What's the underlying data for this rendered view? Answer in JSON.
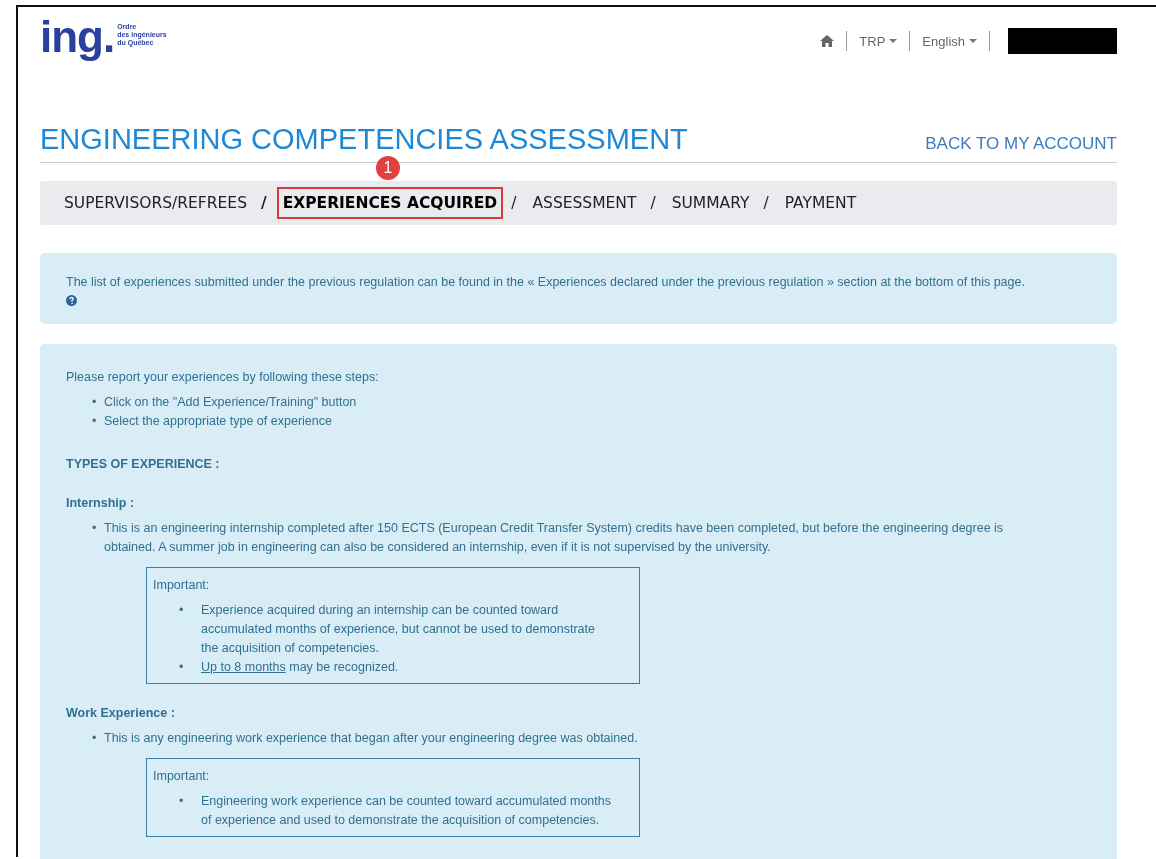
{
  "logo": {
    "wordmark": "ing.",
    "org_lines": [
      "Ordre",
      "des ingénieurs",
      "du Québec"
    ]
  },
  "top_nav": [
    {
      "kind": "home"
    },
    {
      "kind": "dropdown",
      "label": "TRP"
    },
    {
      "kind": "dropdown",
      "label": "English"
    },
    {
      "kind": "redacted"
    }
  ],
  "page_title": "ENGINEERING COMPETENCIES ASSESSMENT",
  "back_link": "BACK TO MY ACCOUNT",
  "steps": [
    {
      "label": "SUPERVISORS/REFREES",
      "selected": false,
      "separator": "/",
      "separator_bold": true
    },
    {
      "label": "EXPERIENCES ACQUIRED",
      "selected": true,
      "separator": "/",
      "separator_bold": false,
      "annotation": "1"
    },
    {
      "label": "ASSESSMENT",
      "selected": false,
      "separator": "/",
      "separator_bold": false
    },
    {
      "label": "SUMMARY",
      "selected": false,
      "separator": "/",
      "separator_bold": false
    },
    {
      "label": "PAYMENT",
      "selected": false
    }
  ],
  "notice": {
    "text": "The list of experiences submitted under the previous regulation can be found in the « Experiences declared under the previous regulation » section at the bottom of this page."
  },
  "bullet": "•",
  "instructions": {
    "intro": "Please report your experiences by following these steps:",
    "steps": [
      "Click on the \"Add Experience/Training\" button",
      "Select the appropriate type of experience"
    ],
    "types_heading": "TYPES OF EXPERIENCE :",
    "types": [
      {
        "title": "Internship :",
        "bullets": [
          "This is an engineering internship completed after 150 ECTS (European Credit Transfer System) credits have been completed, but before the engineering degree is obtained. A summer job in engineering can also be considered an internship, even if it is not supervised by the university."
        ],
        "important": {
          "label": "Important:",
          "items": [
            {
              "text": "Experience acquired during an internship can be counted toward accumulated months of experience, but cannot be used to demonstrate the acquisition of competencies."
            },
            {
              "link": "Up to 8 months",
              "text": " may be recognized."
            }
          ]
        }
      },
      {
        "title": "Work Experience :",
        "bullets": [
          "This is any engineering work experience that began after your engineering degree was obtained."
        ],
        "important": {
          "label": "Important:",
          "items": [
            {
              "text": "Engineering work experience can be counted toward accumulated months of experience and used to demonstrate the acquisition of competencies."
            }
          ]
        }
      }
    ]
  }
}
